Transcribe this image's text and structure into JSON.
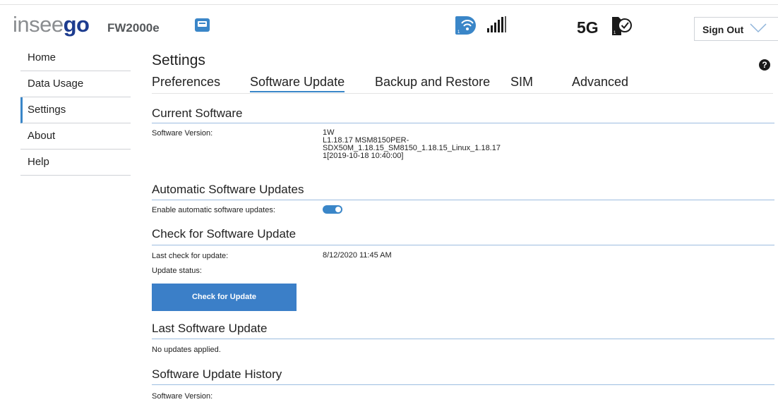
{
  "header": {
    "brand_main": "insee",
    "brand_accent": "go",
    "model": "FW2000e",
    "network_label": "5G",
    "signout_label": "Sign Out",
    "icons": [
      "ethernet-icon",
      "wifi-icon",
      "signal-bars-icon",
      "sim-check-icon",
      "chevron-down-icon",
      "help-icon"
    ]
  },
  "sidebar": {
    "items": [
      {
        "label": "Home"
      },
      {
        "label": "Data Usage"
      },
      {
        "label": "Settings"
      },
      {
        "label": "About"
      },
      {
        "label": "Help"
      }
    ],
    "active": "Settings"
  },
  "main": {
    "title": "Settings",
    "help_glyph": "?",
    "tabs": [
      {
        "label": "Preferences"
      },
      {
        "label": "Software Update"
      },
      {
        "label": "Backup and Restore"
      },
      {
        "label": "SIM"
      },
      {
        "label": "Advanced"
      }
    ],
    "active_tab": "Software Update",
    "current_software": {
      "title": "Current Software",
      "version_label": "Software Version:",
      "version_lines": [
        "1W",
        "L1.18.17 MSM8150PER-",
        "SDX50M_1.18.15_SM8150_1.18.15_Linux_1.18.17",
        "1[2019-10-18 10:40:00]"
      ]
    },
    "auto_updates": {
      "title": "Automatic Software Updates",
      "enable_label": "Enable automatic software updates:",
      "enabled": true
    },
    "check_update": {
      "title": "Check for Software Update",
      "last_check_label": "Last check for update:",
      "last_check_value": "8/12/2020 11:45 AM",
      "status_label": "Update status:",
      "button_label": "Check for Update"
    },
    "last_update": {
      "title": "Last Software Update",
      "text": "No updates applied."
    },
    "history": {
      "title": "Software Update History",
      "version_label": "Software Version:"
    }
  },
  "colors": {
    "accent": "#3a86c8",
    "brand_blue": "#1d3c8f",
    "brand_gray": "#8a8d90",
    "section_rule": "#9cbde0"
  }
}
